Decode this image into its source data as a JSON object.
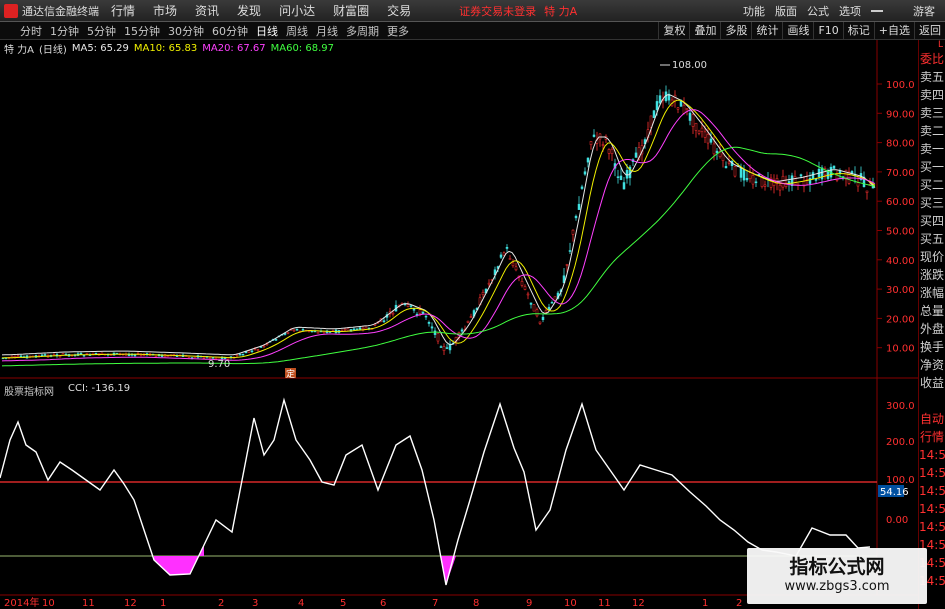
{
  "topbar": {
    "app_title": "通达信金融终端",
    "menu": [
      "行情",
      "市场",
      "资讯",
      "发现",
      "问小达",
      "财富圈",
      "交易"
    ],
    "login_notice": "证券交易未登录",
    "stock_title": "特 力A",
    "right_menu": [
      "功能",
      "版面",
      "公式",
      "选项"
    ],
    "guest": "游客"
  },
  "tabbar": {
    "tabs": [
      "分时",
      "1分钟",
      "5分钟",
      "15分钟",
      "30分钟",
      "60分钟",
      "日线",
      "周线",
      "月线",
      "多周期",
      "更多"
    ],
    "active_tab": "日线",
    "tools": [
      "复权",
      "叠加",
      "多股",
      "统计",
      "画线",
      "F10",
      "标记",
      "+自选",
      "返回"
    ]
  },
  "main_chart": {
    "stock_name": "特 力A",
    "period": "(日线)",
    "ma": [
      {
        "label": "MA5: 65.29",
        "color": "#e8e8e8"
      },
      {
        "label": "MA10: 65.83",
        "color": "#f0f000"
      },
      {
        "label": "MA20: 67.67",
        "color": "#ff40ff"
      },
      {
        "label": "MA60: 68.97",
        "color": "#40ff40"
      }
    ],
    "high_label": "108.00",
    "low_label": "9.70",
    "y_axis_labels": [
      "100.0",
      "90.00",
      "80.00",
      "70.00",
      "60.00",
      "50.00",
      "40.00",
      "30.00",
      "20.00",
      "10.00"
    ],
    "marker": "定"
  },
  "indicator": {
    "source": "股票指标网",
    "cci_label": "CCI: -136.19",
    "y_axis_labels": [
      "300.0",
      "200.0",
      "100.0",
      "0.00"
    ],
    "current_value": "54.16"
  },
  "x_axis": {
    "labels": [
      "2014年",
      "10",
      "11",
      "12",
      "1",
      "2",
      "3",
      "4",
      "5",
      "6",
      "7",
      "8",
      "9",
      "10",
      "11",
      "12",
      "1",
      "2"
    ]
  },
  "quote_panel": {
    "badge": "L",
    "items": [
      "委比",
      "卖五",
      "卖四",
      "卖三",
      "卖二",
      "卖一",
      "买一",
      "买二",
      "买三",
      "买四",
      "买五",
      "现价",
      "涨跌",
      "涨幅",
      "总量",
      "外盘",
      "换手",
      "净资",
      "收益",
      "",
      "自动",
      "行情",
      "14:50",
      "14:50",
      "14:50",
      "14:50",
      "14:50",
      "14:50",
      "14:50",
      "14:50"
    ]
  },
  "watermark": {
    "title": "指标公式网",
    "url": "www.zbgs3.com"
  },
  "colors": {
    "up": "#ff3030",
    "down": "#40e0e0",
    "ma5": "#e8e8e8",
    "ma10": "#f0f000",
    "ma20": "#ff40ff",
    "ma60": "#40ff40",
    "cci": "#ffffff",
    "cci_fill": "#ff30ff"
  }
}
